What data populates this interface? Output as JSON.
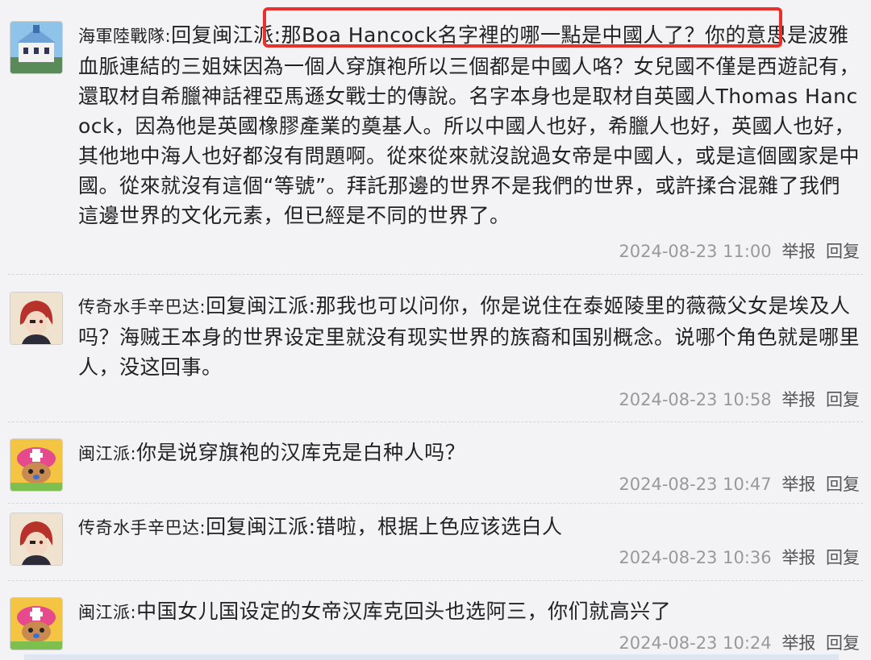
{
  "comments": [
    {
      "username": "海軍陸戰隊",
      "reply_to": "回复闽江派",
      "content": "那Boa Hancock名字裡的哪一點是中國人了？你的意思是波雅血脈連結的三姐妹因為一個人穿旗袍所以三個都是中國人咯？女兒國不僅是西遊記有，還取材自希臘神話裡亞馬遜女戰士的傳說。名字本身也是取材自英國人Thomas Hancock，因為他是英國橡膠產業的奠基人。所以中國人也好，希臘人也好，英國人也好，其他地中海人也好都沒有問題啊。從來從來就沒說過女帝是中國人，或是這個國家是中國。從來就沒有這個“等號”。拜託那邊的世界不是我們的世界，或許揉合混雜了我們這邊世界的文化元素，但已經是不同的世界了。",
      "timestamp": "2024-08-23 11:00",
      "report": "举报",
      "reply": "回复",
      "avatar_icon": "castle-avatar-icon"
    },
    {
      "username": "传奇水手辛巴达",
      "reply_to": "回复闽江派",
      "content": "那我也可以问你，你是说住在泰姬陵里的薇薇父女是埃及人吗？海贼王本身的世界设定里就没有现实世界的族裔和国别概念。说哪个角色就是哪里人，没这回事。",
      "timestamp": "2024-08-23 10:58",
      "report": "举报",
      "reply": "回复",
      "avatar_icon": "redhair-avatar-icon"
    },
    {
      "username": "闽江派",
      "reply_to": "",
      "content": "你是说穿旗袍的汉库克是白种人吗？",
      "timestamp": "2024-08-23 10:47",
      "report": "举报",
      "reply": "回复",
      "avatar_icon": "chopper-avatar-icon"
    },
    {
      "username": "传奇水手辛巴达",
      "reply_to": "回复闽江派",
      "content": "错啦，根据上色应该选白人",
      "timestamp": "2024-08-23 10:36",
      "report": "举报",
      "reply": "回复",
      "avatar_icon": "redhair-avatar-icon"
    },
    {
      "username": "闽江派",
      "reply_to": "",
      "content": "中国女儿国设定的女帝汉库克回头也选阿三，你们就高兴了",
      "timestamp": "2024-08-23 10:24",
      "report": "举报",
      "reply": "回复",
      "avatar_icon": "chopper-avatar-icon"
    }
  ],
  "colors": {
    "background": "#f3f3f5",
    "highlight_border": "#e8312a",
    "meta_text": "#999999"
  }
}
